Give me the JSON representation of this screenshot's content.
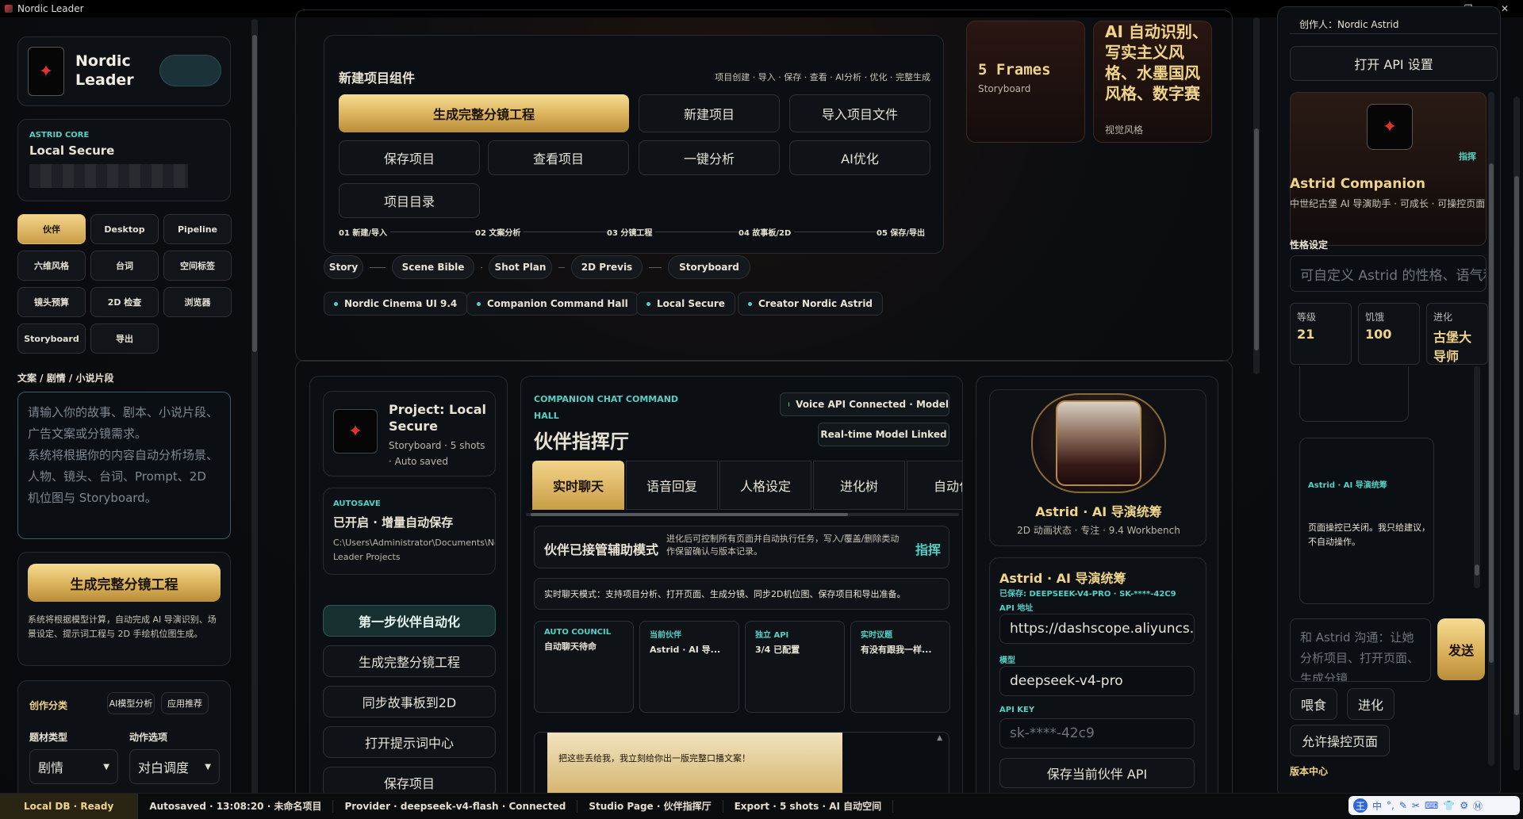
{
  "window": {
    "title": "Nordic Leader"
  },
  "brand": {
    "name_line1": "Nordic",
    "name_line2": "Leader"
  },
  "core": {
    "label": "ASTRID CORE",
    "title": "Local Secure"
  },
  "left_tabs": [
    "伙伴",
    "Desktop",
    "Pipeline",
    "六维风格",
    "台词",
    "空间标签",
    "镜头预算",
    "2D 检查",
    "浏览器",
    "Storyboard",
    "导出"
  ],
  "story": {
    "label": "文案 / 剧情 / 小说片段",
    "placeholder": "请输入你的故事、剧本、小说片段、广告文案或分镜需求。\n系统将根据你的内容自动分析场景、人物、镜头、台词、Prompt、2D 机位图与 Storyboard。"
  },
  "generate": {
    "button": "生成完整分镜工程",
    "desc": "系统将根据模型计算，自动完成 AI 导演识别、场景设定、提示词工程与 2D 手绘机位图生成。"
  },
  "category": {
    "label": "创作分类",
    "btn1": "AI模型分析",
    "btn2": "应用推荐",
    "type_label": "题材类型",
    "action_label": "动作选项",
    "type_value": "剧情",
    "action_value": "对白调度"
  },
  "project_card": {
    "title": "新建项目组件",
    "subtitle": "项目创建 · 导入 · 保存 · 查看 · AI分析 · 优化 · 完整生成",
    "btn_generate": "生成完整分镜工程",
    "btn_new": "新建项目",
    "btn_import": "导入项目文件",
    "btn_save": "保存项目",
    "btn_view": "查看项目",
    "btn_analyze": "一键分析",
    "btn_optimize": "AI优化",
    "btn_dir": "项目目录",
    "steps": [
      "01 新建/导入",
      "02 文案分析",
      "03 分镜工程",
      "04 故事板/2D",
      "05 保存/导出"
    ]
  },
  "frames": {
    "title": "5 Frames",
    "sub": "Storyboard"
  },
  "style": {
    "title": "AI 自动识别、写实主义风格、水墨国风风格、数字赛",
    "sub": "视觉风格"
  },
  "pipeline": [
    "Story",
    "Scene Bible",
    "Shot Plan",
    "2D Previs",
    "Storyboard"
  ],
  "tags": [
    "Nordic Cinema UI 9.4",
    "Companion Command Hall",
    "Local Secure",
    "Creator Nordic Astrid"
  ],
  "project_info": {
    "title": "Project: Local Secure",
    "meta": "Storyboard · 5 shots · Auto saved"
  },
  "autosave": {
    "label": "AUTOSAVE",
    "title": "已开启 · 增量自动保存",
    "path": "C:\\Users\\Administrator\\Documents\\Nordic Leader Projects"
  },
  "actions": [
    "第一步伙伴自动化",
    "生成完整分镜工程",
    "同步故事板到2D",
    "打开提示词中心",
    "保存项目"
  ],
  "chat": {
    "label": "COMPANION CHAT COMMAND HALL",
    "title": "伙伴指挥厅",
    "badge1": "Voice API Connected · Model",
    "badge2": "Real-time Model Linked",
    "tabs": [
      "实时聊天",
      "语音回复",
      "人格设定",
      "进化树",
      "自动化"
    ],
    "mode_title": "伙伴已接管辅助模式",
    "mode_desc": "进化后可控制所有页面并自动执行任务，写入/覆盖/删除类动作保留确认与版本记录。",
    "mode_cmd": "指挥",
    "info": "实时聊天模式：支持项目分析、打开页面、生成分镜、同步2D机位图、保存项目和导出准备。",
    "tiles": [
      {
        "k": "AUTO COUNCIL",
        "v": "自动聊天待命"
      },
      {
        "k": "当前伙伴",
        "v": "Astrid · AI 导..."
      },
      {
        "k": "独立 API",
        "v": "3/4 已配置"
      },
      {
        "k": "实时议题",
        "v": "有没有跟我一样..."
      }
    ],
    "msg": "把这些丢给我，我立刻给你出一版完整口播文案！"
  },
  "astrid": {
    "name": "Astrid · AI 导演统筹",
    "sub": "2D 动画状态 · 专注 · 9.4 Workbench"
  },
  "api": {
    "title": "Astrid · AI 导演统筹",
    "saved": "已保存: DEEPSEEK-V4-PRO · SK-****-42C9",
    "url_label": "API 地址",
    "url_value": "https://dashscope.aliyuncs.co",
    "model_label": "模型",
    "model_value": "deepseek-v4-pro",
    "key_label": "API KEY",
    "key_placeholder": "sk-****-42c9",
    "save_btn": "保存当前伙伴 API"
  },
  "right": {
    "creator": "创作人：Nordic Astrid",
    "open_api": "打开 API 设置",
    "cmd": "指挥",
    "companion_title": "Astrid Companion",
    "companion_desc": "中世纪古堡 AI 导演助手 · 可成长 · 可操控页面",
    "persona_label": "性格设定",
    "persona_placeholder": "可自定义 Astrid 的性格、语气和",
    "stats": [
      {
        "k": "等级",
        "v": "21"
      },
      {
        "k": "饥饿",
        "v": "100"
      },
      {
        "k": "进化",
        "v": "古堡大导师"
      }
    ],
    "bubble_title": "Astrid · AI 导演统筹",
    "bubble_text": "页面操控已关闭。我只给建议，不自动操作。",
    "chat_placeholder": "和 Astrid 沟通：让她分析项目、打开页面、生成分镜",
    "send": "发送",
    "feed": "喂食",
    "evolve": "进化",
    "allow": "允许操控页面",
    "version": "版本中心"
  },
  "status": [
    "Local DB · Ready",
    "Autosaved · 13:08:20 · 未命名项目",
    "Provider · deepseek-v4-flash · Connected",
    "Studio Page · 伙伴指挥厅",
    "Export · 5 shots · AI 自动空间"
  ],
  "tray": [
    "王",
    "中",
    "°,",
    "✎",
    "✂",
    "⌨",
    "👕",
    "⚙",
    "Ⓜ"
  ]
}
